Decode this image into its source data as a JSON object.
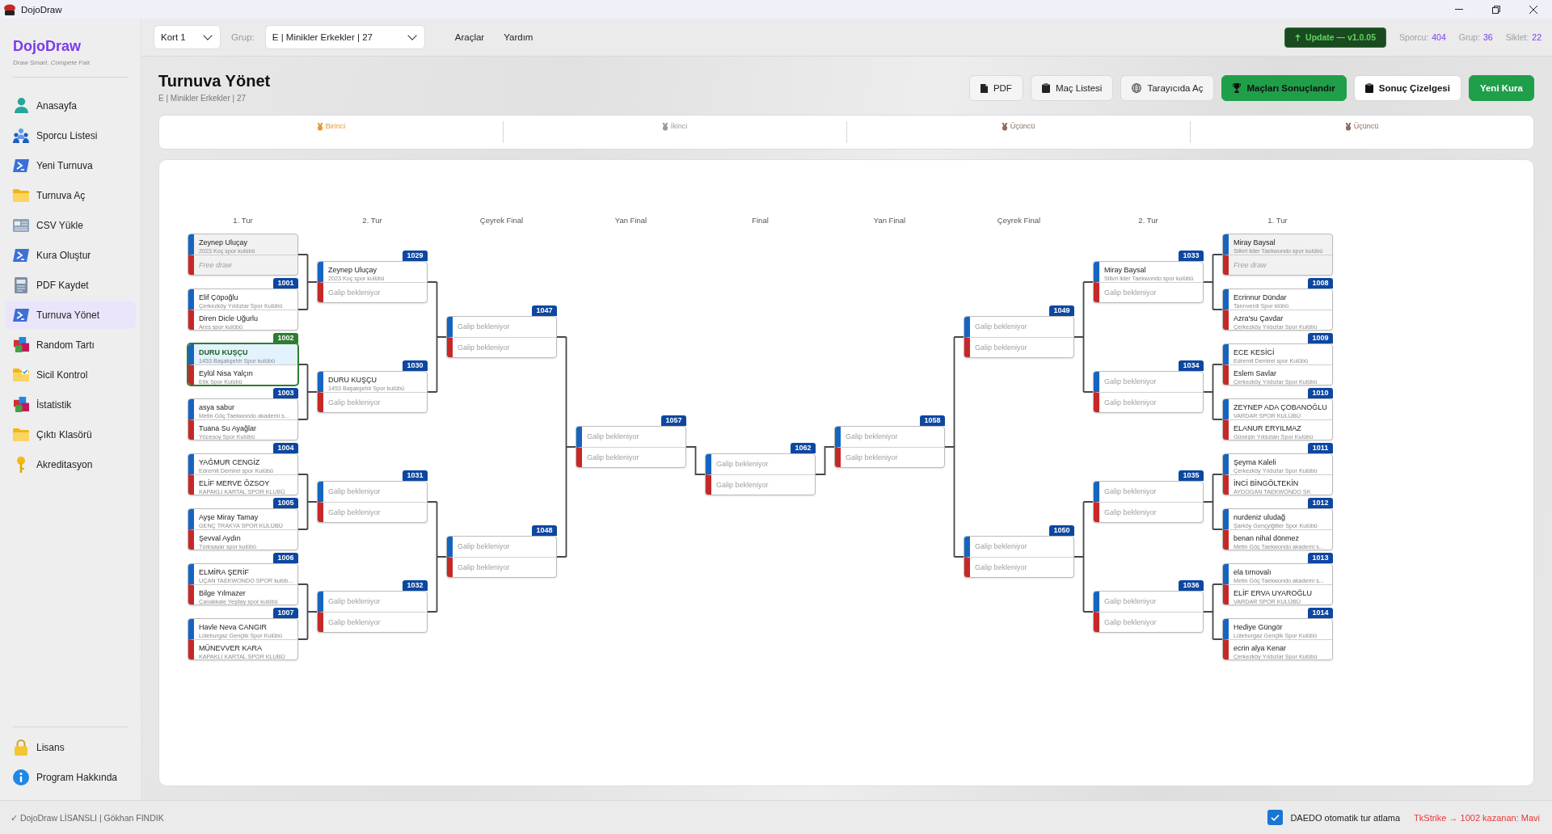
{
  "window": {
    "title": "DojoDraw"
  },
  "sidebar": {
    "brand": "DojoDraw",
    "tagline": "Draw Smart. Compete Fair.",
    "items": [
      {
        "label": "Anasayfa",
        "selected": false
      },
      {
        "label": "Sporcu Listesi",
        "selected": false
      },
      {
        "label": "Yeni Turnuva",
        "selected": false
      },
      {
        "label": "Turnuva Aç",
        "selected": false
      },
      {
        "label": "CSV Yükle",
        "selected": false
      },
      {
        "label": "Kura Oluştur",
        "selected": false
      },
      {
        "label": "PDF Kaydet",
        "selected": false
      },
      {
        "label": "Turnuva Yönet",
        "selected": true
      },
      {
        "label": "Random Tartı",
        "selected": false
      },
      {
        "label": "Sicil Kontrol",
        "selected": false
      },
      {
        "label": "İstatistik",
        "selected": false
      },
      {
        "label": "Çıktı Klasörü",
        "selected": false
      },
      {
        "label": "Akreditasyon",
        "selected": false
      }
    ],
    "footer_items": [
      {
        "label": "Lisans",
        "selected": false
      },
      {
        "label": "Program Hakkında",
        "selected": false
      }
    ]
  },
  "toolbar": {
    "court": "Kort 1",
    "group_label": "Grup:",
    "group": "E | Minikler Erkekler | 27",
    "menus": [
      "Araçlar",
      "Yardım"
    ],
    "update": "Update — v1.0.05",
    "stats": [
      {
        "label": "Sporcu:",
        "value": "404"
      },
      {
        "label": "Grup:",
        "value": "36"
      },
      {
        "label": "Siklet:",
        "value": "22"
      }
    ]
  },
  "page": {
    "title": "Turnuva Yönet",
    "subtitle": "E | Minikler Erkekler | 27",
    "actions": [
      {
        "label": "PDF",
        "kind": "secondary"
      },
      {
        "label": "Maç Listesi",
        "kind": "secondary"
      },
      {
        "label": "Tarayıcıda Aç",
        "kind": "secondary"
      },
      {
        "label": "Maçları Sonuçlandır",
        "kind": "confirm"
      },
      {
        "label": "Sonuç Çizelgesi",
        "kind": "outline"
      },
      {
        "label": "Yeni Kura",
        "kind": "primary"
      }
    ]
  },
  "podium": {
    "places": [
      {
        "label": "Birinci",
        "color": "#e8982f"
      },
      {
        "label": "İkinci",
        "color": "#9a9a9a"
      },
      {
        "label": "Üçüncü",
        "color": "#8d6e63"
      },
      {
        "label": "Üçüncü",
        "color": "#8d6e63"
      }
    ]
  },
  "bracket": {
    "columns": [
      {
        "header": "1. Tur",
        "matches": [
          {
            "kind": "bye",
            "selected": false,
            "slots": [
              {
                "kind": "athlete",
                "name": "Zeynep Uluçay",
                "club": "2023 Koç spor kulübü",
                "winner": false
              },
              {
                "kind": "bye",
                "text": "Free draw",
                "winner": false
              }
            ]
          },
          {
            "number": "1001",
            "kind": "match",
            "selected": false,
            "slots": [
              {
                "kind": "athlete",
                "name": "Elif Çöpoğlu",
                "club": "Çerkezköy Yıldızlar Spor Kulübü",
                "winner": false
              },
              {
                "kind": "athlete",
                "name": "Diren Dicle Uğurlu",
                "club": "Ares spor kulübü",
                "winner": false
              }
            ]
          },
          {
            "number": "1002",
            "kind": "match",
            "selected": true,
            "slots": [
              {
                "kind": "athlete",
                "name": "DURU KUŞÇU",
                "club": "1453 Başakşehir Spor kulübü",
                "winner": true
              },
              {
                "kind": "athlete",
                "name": "Eylül Nisa Yalçın",
                "club": "Etik Spor Kulübü",
                "winner": false
              }
            ]
          },
          {
            "number": "1003",
            "kind": "match",
            "selected": false,
            "slots": [
              {
                "kind": "athlete",
                "name": "asya sabur",
                "club": "Metin Göç Taekwondo akademi s...",
                "winner": false
              },
              {
                "kind": "athlete",
                "name": "Tuana Su Ayağlar",
                "club": "Yücesoy Spor Kulübü",
                "winner": false
              }
            ]
          },
          {
            "number": "1004",
            "kind": "match",
            "selected": false,
            "slots": [
              {
                "kind": "athlete",
                "name": "YAĞMUR CENGİZ",
                "club": "Edremit Demirel spor Kulübü",
                "winner": false
              },
              {
                "kind": "athlete",
                "name": "ELİF MERVE ÖZSOY",
                "club": "KAPAKLI KARTAL SPOR KLUBÜ",
                "winner": false
              }
            ]
          },
          {
            "number": "1005",
            "kind": "match",
            "selected": false,
            "slots": [
              {
                "kind": "athlete",
                "name": "Ayşe Miray Tamay",
                "club": "GENÇ TRAKYA SPOR KULÜBÜ",
                "winner": false
              },
              {
                "kind": "athlete",
                "name": "Şevval Aydın",
                "club": "Türksayar spor kulübü",
                "winner": false
              }
            ]
          },
          {
            "number": "1006",
            "kind": "match",
            "selected": false,
            "slots": [
              {
                "kind": "athlete",
                "name": "ELMİRA ŞERİF",
                "club": "UÇAN TAEKWONDO SPOR kulüb...",
                "winner": false
              },
              {
                "kind": "athlete",
                "name": "Bilge Yılmazer",
                "club": "Çanakkale Yeşilay spor kulübü",
                "winner": false
              }
            ]
          },
          {
            "number": "1007",
            "kind": "match",
            "selected": false,
            "slots": [
              {
                "kind": "athlete",
                "name": "Havle Neva CANGIR",
                "club": "Lüleburgaz Gençlik Spor Kulübü",
                "winner": false
              },
              {
                "kind": "athlete",
                "name": "MÜNEVVER KARA",
                "club": "KAPAKLI KARTAL SPOR KLUBÜ",
                "winner": false
              }
            ]
          }
        ]
      },
      {
        "header": "2. Tur",
        "matches": [
          {
            "number": "1029",
            "kind": "match",
            "selected": false,
            "slots": [
              {
                "kind": "athlete",
                "name": "Zeynep Uluçay",
                "club": "2023 Koç spor kulübü",
                "winner": false
              },
              {
                "kind": "waiting",
                "text": "Galip bekleniyor",
                "winner": false
              }
            ]
          },
          {
            "number": "1030",
            "kind": "match",
            "selected": false,
            "slots": [
              {
                "kind": "athlete",
                "name": "DURU KUŞÇU",
                "club": "1453 Başakşehir Spor kulübü",
                "winner": false
              },
              {
                "kind": "waiting",
                "text": "Galip bekleniyor",
                "winner": false
              }
            ]
          },
          {
            "number": "1031",
            "kind": "match",
            "selected": false,
            "slots": [
              {
                "kind": "waiting",
                "text": "Galip bekleniyor",
                "winner": false
              },
              {
                "kind": "waiting",
                "text": "Galip bekleniyor",
                "winner": false
              }
            ]
          },
          {
            "number": "1032",
            "kind": "match",
            "selected": false,
            "slots": [
              {
                "kind": "waiting",
                "text": "Galip bekleniyor",
                "winner": false
              },
              {
                "kind": "waiting",
                "text": "Galip bekleniyor",
                "winner": false
              }
            ]
          }
        ]
      },
      {
        "header": "Çeyrek Final",
        "matches": [
          {
            "number": "1047",
            "kind": "match",
            "selected": false,
            "slots": [
              {
                "kind": "waiting",
                "text": "Galip bekleniyor",
                "winner": false
              },
              {
                "kind": "waiting",
                "text": "Galip bekleniyor",
                "winner": false
              }
            ]
          },
          {
            "number": "1048",
            "kind": "match",
            "selected": false,
            "slots": [
              {
                "kind": "waiting",
                "text": "Galip bekleniyor",
                "winner": false
              },
              {
                "kind": "waiting",
                "text": "Galip bekleniyor",
                "winner": false
              }
            ]
          }
        ]
      },
      {
        "header": "Yan Final",
        "matches": [
          {
            "number": "1057",
            "kind": "match",
            "selected": false,
            "slots": [
              {
                "kind": "waiting",
                "text": "Galip bekleniyor",
                "winner": false
              },
              {
                "kind": "waiting",
                "text": "Galip bekleniyor",
                "winner": false
              }
            ]
          }
        ]
      },
      {
        "header": "Final",
        "matches": [
          {
            "number": "1062",
            "kind": "match",
            "selected": false,
            "slots": [
              {
                "kind": "waiting",
                "text": "Galip bekleniyor",
                "winner": false
              },
              {
                "kind": "waiting",
                "text": "Galip bekleniyor",
                "winner": false
              }
            ]
          }
        ]
      },
      {
        "header": "Yan Final",
        "matches": [
          {
            "number": "1058",
            "kind": "match",
            "selected": false,
            "slots": [
              {
                "kind": "waiting",
                "text": "Galip bekleniyor",
                "winner": false
              },
              {
                "kind": "waiting",
                "text": "Galip bekleniyor",
                "winner": false
              }
            ]
          }
        ]
      },
      {
        "header": "Çeyrek Final",
        "matches": [
          {
            "number": "1049",
            "kind": "match",
            "selected": false,
            "slots": [
              {
                "kind": "waiting",
                "text": "Galip bekleniyor",
                "winner": false
              },
              {
                "kind": "waiting",
                "text": "Galip bekleniyor",
                "winner": false
              }
            ]
          },
          {
            "number": "1050",
            "kind": "match",
            "selected": false,
            "slots": [
              {
                "kind": "waiting",
                "text": "Galip bekleniyor",
                "winner": false
              },
              {
                "kind": "waiting",
                "text": "Galip bekleniyor",
                "winner": false
              }
            ]
          }
        ]
      },
      {
        "header": "2. Tur",
        "matches": [
          {
            "number": "1033",
            "kind": "match",
            "selected": false,
            "slots": [
              {
                "kind": "athlete",
                "name": "Miray Baysal",
                "club": "Silivri lider Taekwondo spor kulübü",
                "winner": false
              },
              {
                "kind": "waiting",
                "text": "Galip bekleniyor",
                "winner": false
              }
            ]
          },
          {
            "number": "1034",
            "kind": "match",
            "selected": false,
            "slots": [
              {
                "kind": "waiting",
                "text": "Galip bekleniyor",
                "winner": false
              },
              {
                "kind": "waiting",
                "text": "Galip bekleniyor",
                "winner": false
              }
            ]
          },
          {
            "number": "1035",
            "kind": "match",
            "selected": false,
            "slots": [
              {
                "kind": "waiting",
                "text": "Galip bekleniyor",
                "winner": false
              },
              {
                "kind": "waiting",
                "text": "Galip bekleniyor",
                "winner": false
              }
            ]
          },
          {
            "number": "1036",
            "kind": "match",
            "selected": false,
            "slots": [
              {
                "kind": "waiting",
                "text": "Galip bekleniyor",
                "winner": false
              },
              {
                "kind": "waiting",
                "text": "Galip bekleniyor",
                "winner": false
              }
            ]
          }
        ]
      },
      {
        "header": "1. Tur",
        "matches": [
          {
            "kind": "bye",
            "selected": false,
            "slots": [
              {
                "kind": "athlete",
                "name": "Miray Baysal",
                "club": "Silivri lider Taekwondo spor kulübü",
                "winner": false
              },
              {
                "kind": "bye",
                "text": "Free draw",
                "winner": false
              }
            ]
          },
          {
            "number": "1008",
            "kind": "match",
            "selected": false,
            "slots": [
              {
                "kind": "athlete",
                "name": "Ecrinnur Dündar",
                "club": "Tanrıverdi Spor klübü",
                "winner": false
              },
              {
                "kind": "athlete",
                "name": "Azra'su Çavdar",
                "club": "Çerkezköy Yıldızlar Spor Kulübü",
                "winner": false
              }
            ]
          },
          {
            "number": "1009",
            "kind": "match",
            "selected": false,
            "slots": [
              {
                "kind": "athlete",
                "name": "ECE KESİCİ",
                "club": "Edremit Demirel spor Kulübü",
                "winner": false
              },
              {
                "kind": "athlete",
                "name": "Eslem Savlar",
                "club": "Çerkezköy Yıldızlar Spor Kulübü",
                "winner": false
              }
            ]
          },
          {
            "number": "1010",
            "kind": "match",
            "selected": false,
            "slots": [
              {
                "kind": "athlete",
                "name": "ZEYNEP ADA ÇOBANOĞLU",
                "club": "VARDAR SPOR KULÜBÜ",
                "winner": false
              },
              {
                "kind": "athlete",
                "name": "ELANUR ERYILMAZ",
                "club": "Güneşin Yıldızları Spor Kulübü",
                "winner": false
              }
            ]
          },
          {
            "number": "1011",
            "kind": "match",
            "selected": false,
            "slots": [
              {
                "kind": "athlete",
                "name": "Şeyma Kaleli",
                "club": "Çerkezköy Yıldızlar Spor Kulübü",
                "winner": false
              },
              {
                "kind": "athlete",
                "name": "İNCİ BİNGÖLTEKİN",
                "club": "AYDOGAN TAEKWONDO SK",
                "winner": false
              }
            ]
          },
          {
            "number": "1012",
            "kind": "match",
            "selected": false,
            "slots": [
              {
                "kind": "athlete",
                "name": "nurdeniz uludağ",
                "club": "Şarköy Gençyiğitler Spor Kulübü",
                "winner": false
              },
              {
                "kind": "athlete",
                "name": "benan nihal dönmez",
                "club": "Metin Göç Taekwondo akademi s...",
                "winner": false
              }
            ]
          },
          {
            "number": "1013",
            "kind": "match",
            "selected": false,
            "slots": [
              {
                "kind": "athlete",
                "name": "ela tırnovalı",
                "club": "Metin Göç Taekwondo akademi s...",
                "winner": false
              },
              {
                "kind": "athlete",
                "name": "ELİF ERVA UYAROĞLU",
                "club": "VARDAR SPOR KULÜBÜ",
                "winner": false
              }
            ]
          },
          {
            "number": "1014",
            "kind": "match",
            "selected": false,
            "slots": [
              {
                "kind": "athlete",
                "name": "Hediye Güngör",
                "club": "Lüleburgaz Gençlik Spor Kulübü",
                "winner": false
              },
              {
                "kind": "athlete",
                "name": "ecrin alya Kenar",
                "club": "Çerkezköy Yıldızlar Spor Kulübü",
                "winner": false
              }
            ]
          }
        ]
      }
    ]
  },
  "status_bar": {
    "license": "✓ DojoDraw LİSANSLI | Gökhan FINDIK",
    "auto_advance": {
      "label": "DAEDO otomatik tur atlama",
      "checked": true
    },
    "message": "TkStrike → 1002 kazanan: Mavi"
  }
}
